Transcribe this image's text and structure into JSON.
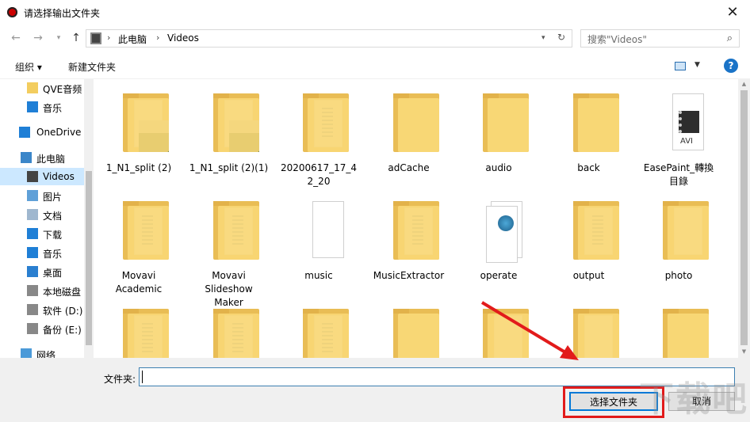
{
  "window": {
    "title": "请选择输出文件夹"
  },
  "address": {
    "crumbs": [
      "此电脑",
      "Videos"
    ]
  },
  "search": {
    "placeholder": "搜索\"Videos\""
  },
  "toolbar": {
    "organize": "组织 ▾",
    "new_folder": "新建文件夹",
    "help": "?"
  },
  "sidebar": {
    "items": [
      {
        "label": "QVE音频",
        "icon": "folder-icon"
      },
      {
        "label": "音乐",
        "icon": "music-icon"
      },
      {
        "label": "OneDrive",
        "icon": "cloud-icon"
      },
      {
        "label": "此电脑",
        "icon": "computer-icon"
      },
      {
        "label": "Videos",
        "icon": "video-icon",
        "selected": true
      },
      {
        "label": "图片",
        "icon": "pictures-icon"
      },
      {
        "label": "文档",
        "icon": "documents-icon"
      },
      {
        "label": "下载",
        "icon": "download-icon"
      },
      {
        "label": "音乐",
        "icon": "music-icon"
      },
      {
        "label": "桌面",
        "icon": "desktop-icon"
      },
      {
        "label": "本地磁盘",
        "icon": "drive-icon"
      },
      {
        "label": "软件 (D:)",
        "icon": "drive-icon"
      },
      {
        "label": "备份 (E:)",
        "icon": "drive-icon"
      },
      {
        "label": "网络",
        "icon": "network-icon"
      }
    ]
  },
  "files": [
    {
      "name": "1_N1_split (2)",
      "kind": "folder-image"
    },
    {
      "name": "1_N1_split (2)(1)",
      "kind": "folder-image"
    },
    {
      "name": "20200617_17_4\n2_20",
      "kind": "folder-doc"
    },
    {
      "name": "adCache",
      "kind": "folder"
    },
    {
      "name": "audio",
      "kind": "folder"
    },
    {
      "name": "back",
      "kind": "folder"
    },
    {
      "name": "EasePaint_轉換\n目錄",
      "kind": "avi"
    },
    {
      "name": "Movavi\nAcademic",
      "kind": "folder-doc"
    },
    {
      "name": "Movavi\nSlideshow\nMaker",
      "kind": "folder-doc"
    },
    {
      "name": "music",
      "kind": "file"
    },
    {
      "name": "MusicExtractor",
      "kind": "folder-doc"
    },
    {
      "name": "operate",
      "kind": "web-doc"
    },
    {
      "name": "output",
      "kind": "folder-doc"
    },
    {
      "name": "photo",
      "kind": "folder-file"
    },
    {
      "name": "",
      "kind": "folder-doc"
    },
    {
      "name": "",
      "kind": "folder-doc"
    },
    {
      "name": "",
      "kind": "folder-doc"
    },
    {
      "name": "",
      "kind": "folder"
    },
    {
      "name": "",
      "kind": "folder-file"
    },
    {
      "name": "",
      "kind": "folder-file"
    },
    {
      "name": "",
      "kind": "folder"
    }
  ],
  "footer": {
    "folder_label": "文件夹:",
    "folder_value": "",
    "select_button": "选择文件夹",
    "cancel_button": "取消"
  },
  "colors": {
    "accent": "#0078d7",
    "highlight": "#e21b1b",
    "selection": "#cce8ff"
  }
}
